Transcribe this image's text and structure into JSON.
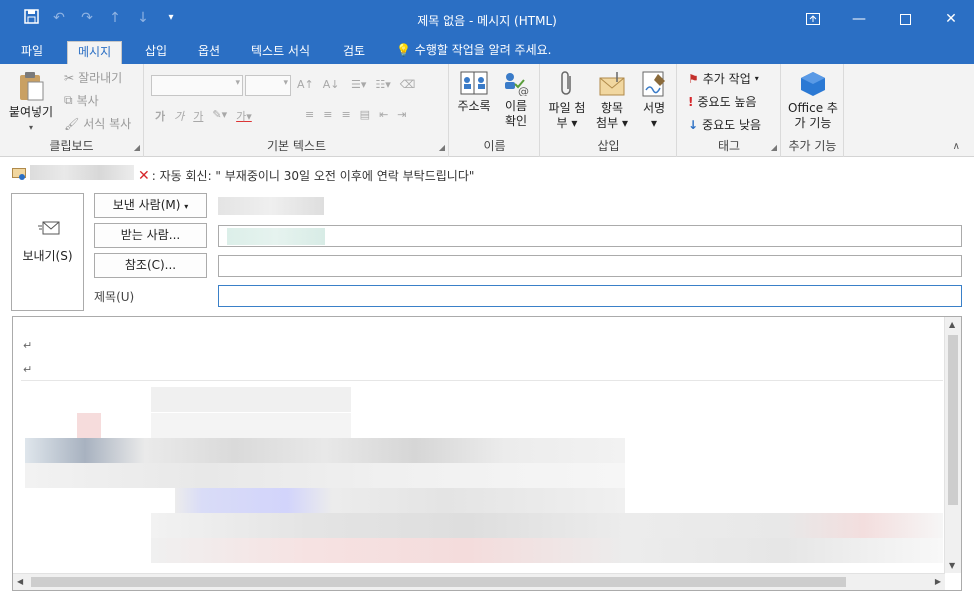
{
  "window": {
    "title": "제목 없음 - 메시지 (HTML)"
  },
  "tabs": [
    {
      "label": "파일"
    },
    {
      "label": "메시지"
    },
    {
      "label": "삽입"
    },
    {
      "label": "옵션"
    },
    {
      "label": "텍스트 서식"
    },
    {
      "label": "검토"
    }
  ],
  "tell_me": "수행할 작업을 알려 주세요.",
  "ribbon": {
    "clipboard": {
      "label": "클립보드",
      "paste": "붙여넣기",
      "cut": "잘라내기",
      "copy": "복사",
      "format_painter": "서식 복사"
    },
    "basic_text": {
      "label": "기본 텍스트"
    },
    "names": {
      "label": "이름",
      "address_book": "주소록",
      "check_names_1": "이름",
      "check_names_2": "확인"
    },
    "include": {
      "label": "삽입",
      "attach_file_1": "파일 첨",
      "attach_file_2": "부",
      "attach_item_1": "항목",
      "attach_item_2": "첨부",
      "signature": "서명"
    },
    "tags": {
      "label": "태그",
      "follow_up": "추가 작업",
      "high_importance": "중요도 높음",
      "low_importance": "중요도 낮음"
    },
    "addins": {
      "label": "추가 기능",
      "office_addins_1": "Office 추",
      "office_addins_2": "가 기능"
    }
  },
  "infobar": {
    "message": ": 자동 회신: \"   부재중이니 30일 오전 이후에 연락 부탁드립니다\""
  },
  "compose": {
    "send": "보내기(S)",
    "from": "보낸 사람(M)",
    "to": "받는 사람...",
    "cc": "참조(C)...",
    "subject_label": "제목(U)"
  },
  "colors": {
    "accent": "#2b6fc4",
    "ribbon_bg": "#f3f3f3"
  }
}
